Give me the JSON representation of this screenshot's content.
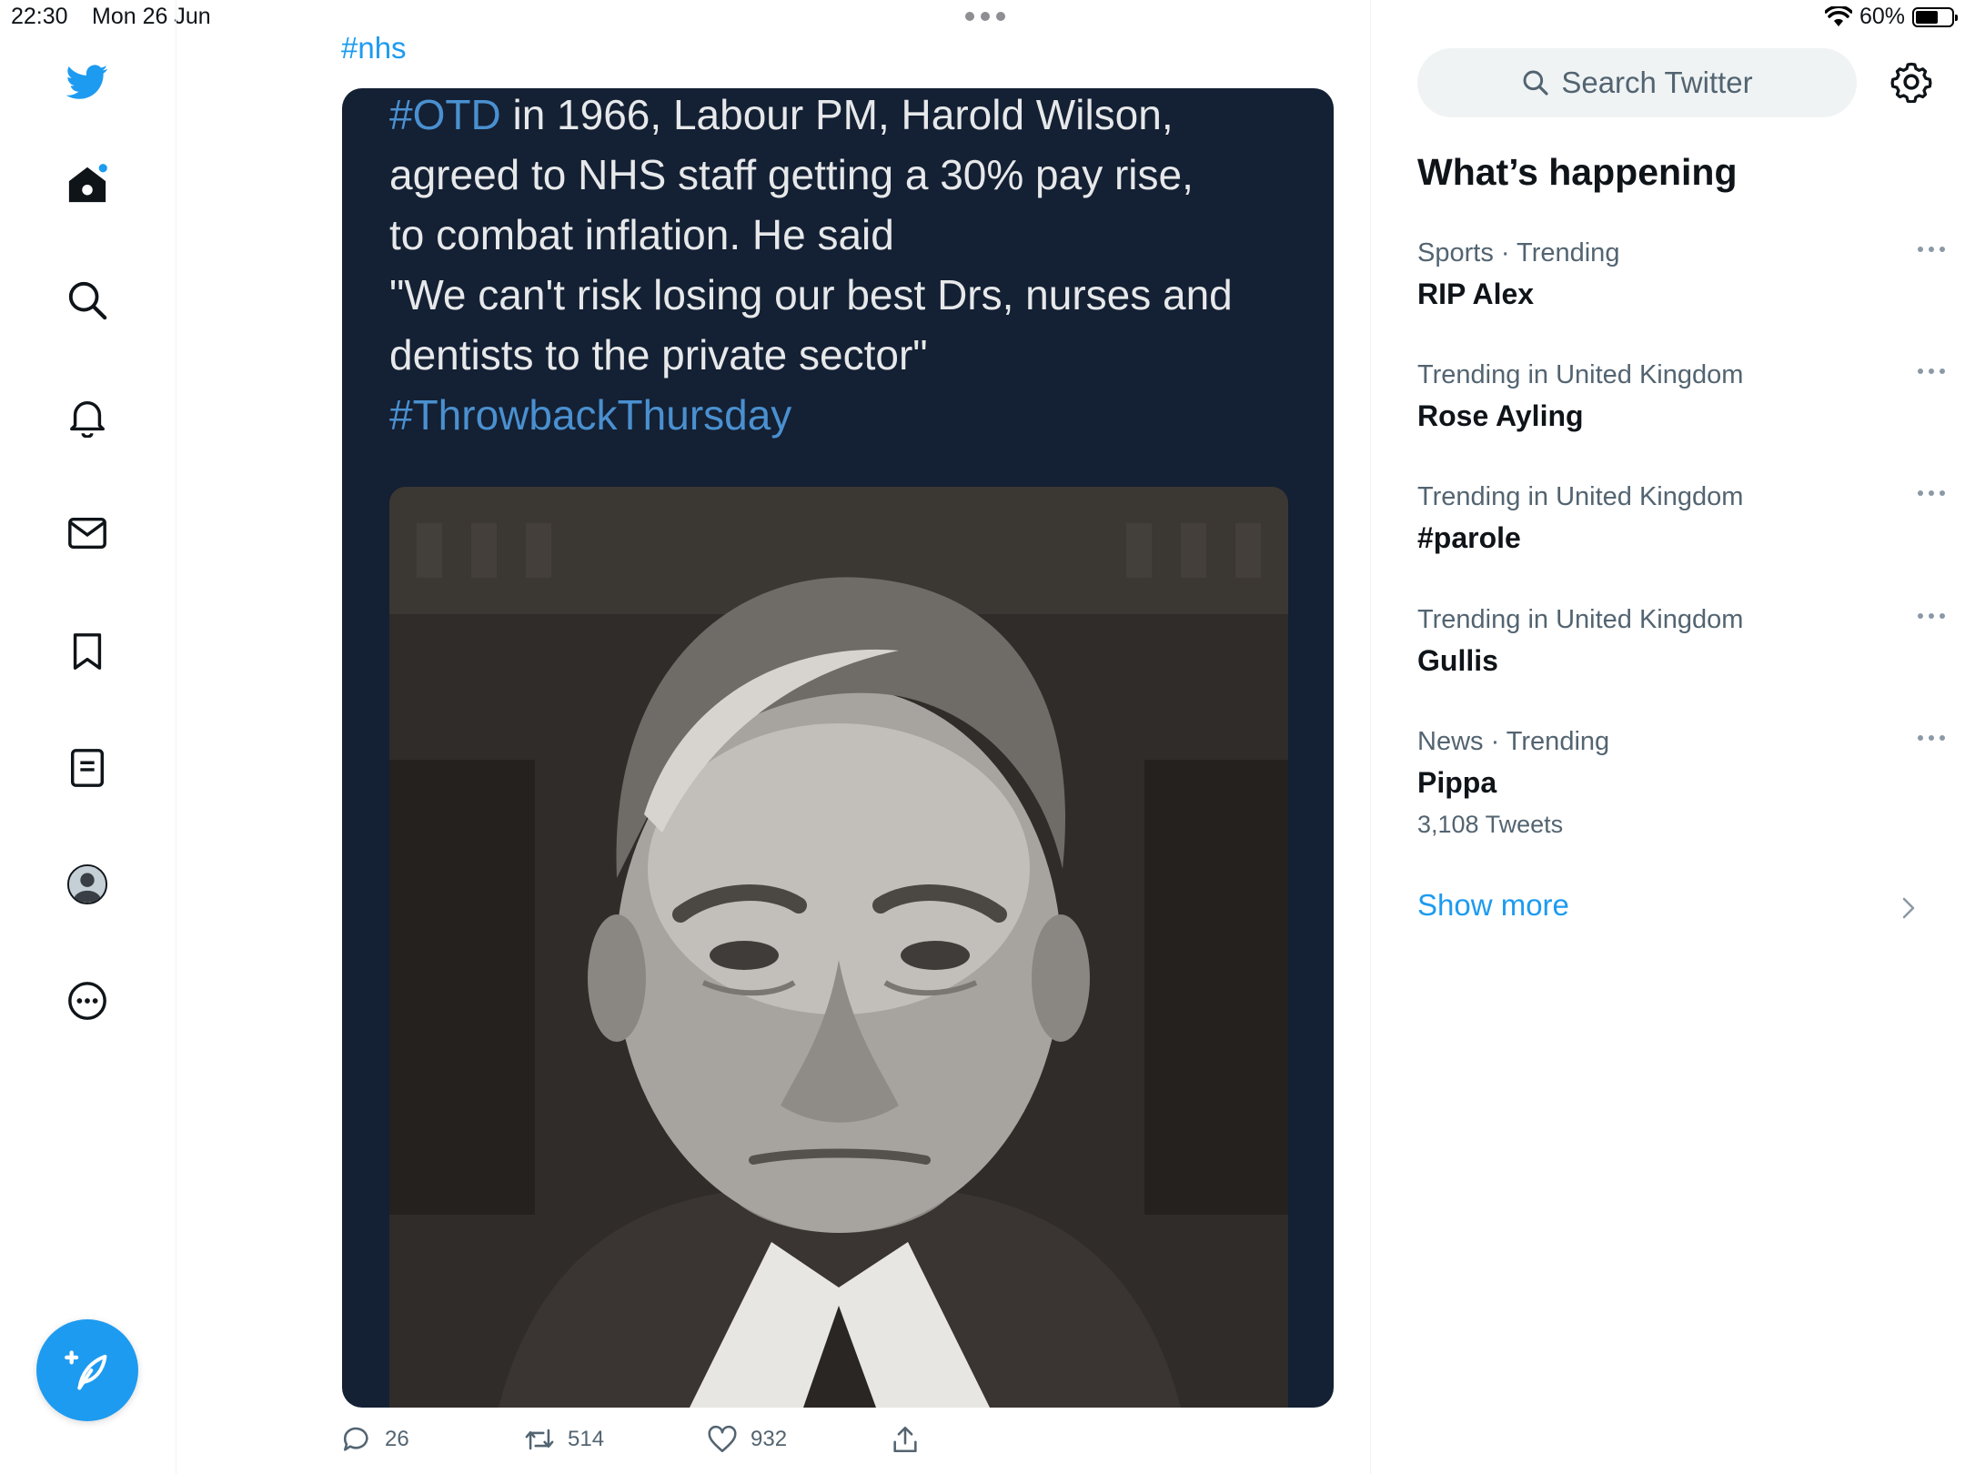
{
  "status_bar": {
    "time": "22:30",
    "date": "Mon 26 Jun",
    "battery": "60%",
    "battery_level": 0.6
  },
  "nav": {
    "items": [
      "twitter-logo",
      "home-icon",
      "search-icon",
      "bell-icon",
      "mail-icon",
      "bookmark-icon",
      "list-icon",
      "profile-avatar",
      "more-icon"
    ],
    "accent_color": "#1d9bf0"
  },
  "tweet": {
    "hashtag": "#nhs",
    "media_text": {
      "tag1": "#OTD",
      "line1_rest": " in 1966, Labour PM, Harold Wilson,",
      "line2": "agreed to NHS staff getting  a 30% pay rise,",
      "line3": "to combat inflation. He said",
      "line4": "\"We can't risk losing our best Drs, nurses and",
      "line5": "dentists to the private sector\"",
      "tag2": "#ThrowbackThursday"
    },
    "actions": {
      "replies": "26",
      "retweets": "514",
      "likes": "932"
    }
  },
  "sidebar": {
    "search_placeholder": "Search Twitter",
    "title": "What’s happening",
    "trends": [
      {
        "category": "Sports · Trending",
        "name": "RIP Alex"
      },
      {
        "category": "Trending in United Kingdom",
        "name": "Rose Ayling"
      },
      {
        "category": "Trending in United Kingdom",
        "name": "#parole"
      },
      {
        "category": "Trending in United Kingdom",
        "name": "Gullis"
      },
      {
        "category": "News · Trending",
        "name": "Pippa",
        "count": "3,108 Tweets"
      }
    ],
    "show_more": "Show more"
  }
}
